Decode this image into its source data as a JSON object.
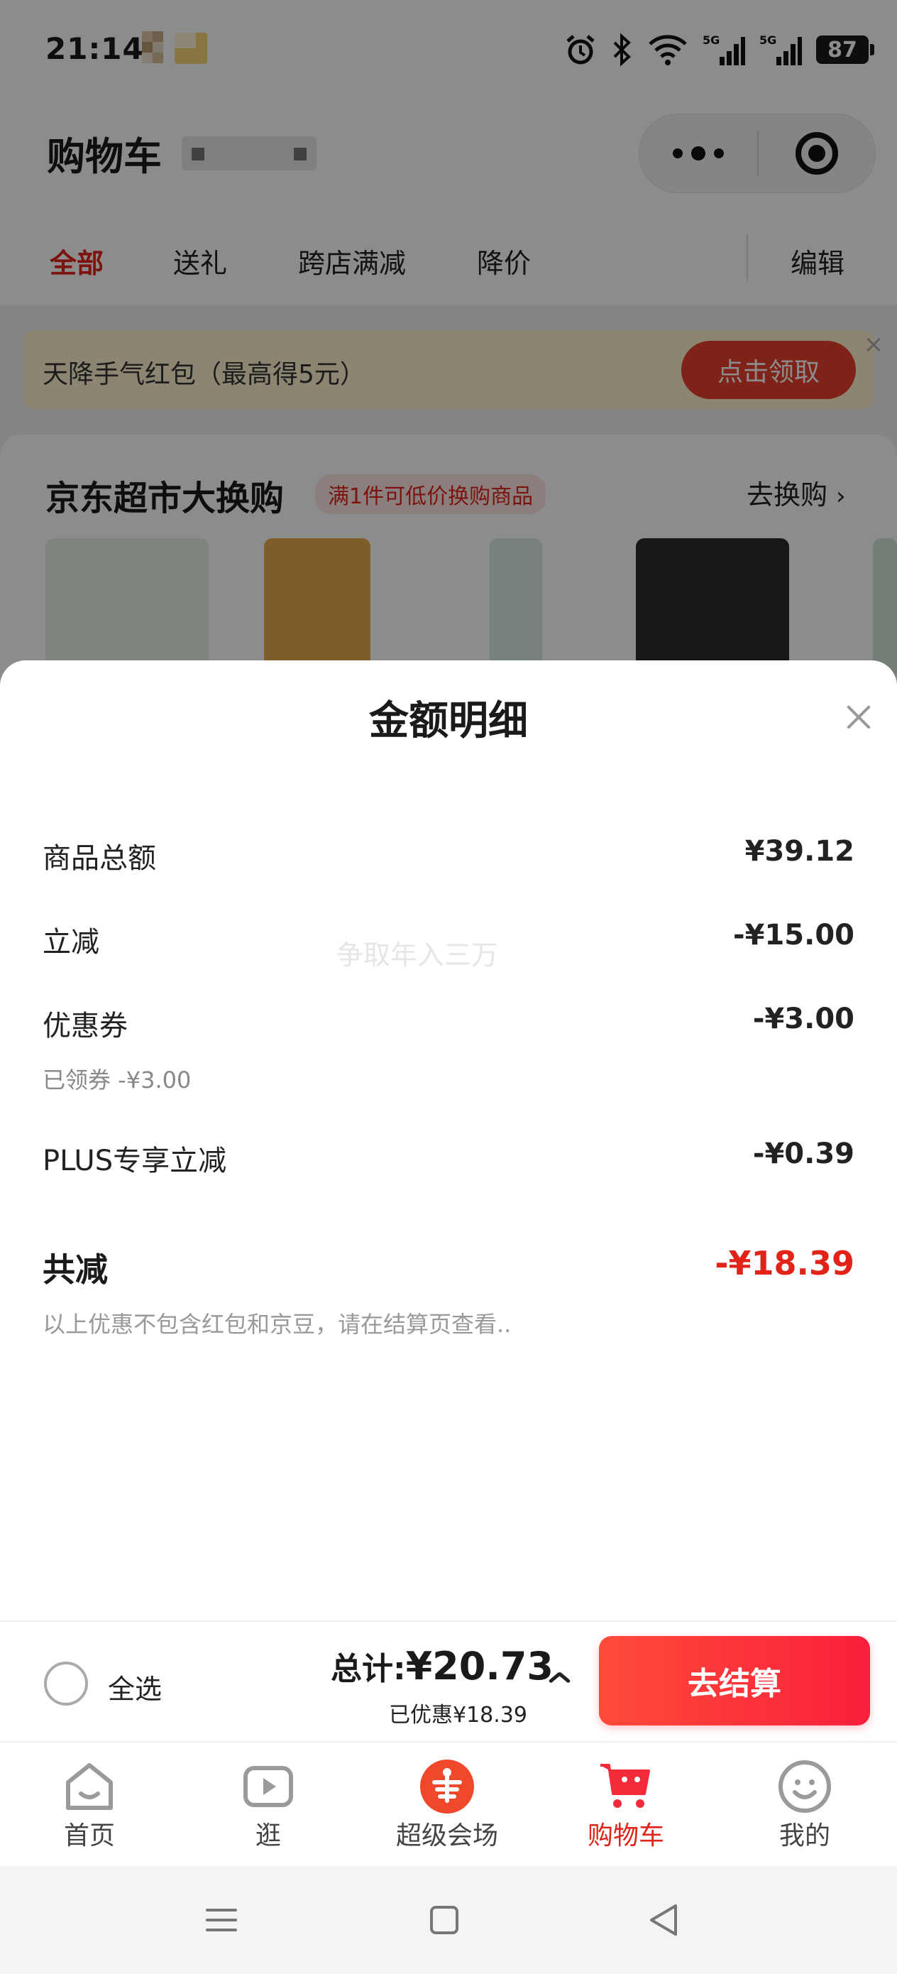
{
  "status_bar": {
    "time": "21:14",
    "battery": "87"
  },
  "header": {
    "title": "购物车"
  },
  "tabs": [
    {
      "label": "全部",
      "active": true
    },
    {
      "label": "送礼"
    },
    {
      "label": "跨店满减"
    },
    {
      "label": "降价"
    }
  ],
  "tabs_edit": "编辑",
  "banner": {
    "text": "天降手气红包（最高得5元）",
    "button": "点击领取"
  },
  "swap": {
    "title": "京东超市大换购",
    "tag": "满1件可低价换购商品",
    "link": "去换购",
    "link_arrow": "›"
  },
  "sheet": {
    "title": "金额明细",
    "watermark": "争取年入三万",
    "rows": [
      {
        "label": "商品总额",
        "value": "¥39.12"
      },
      {
        "label": "立减",
        "value": "-¥15.00"
      },
      {
        "label": "优惠券",
        "value": "-¥3.00",
        "sub": "已领券 -¥3.00"
      },
      {
        "label": "PLUS专享立减",
        "value": "-¥0.39"
      }
    ],
    "total": {
      "label": "共减",
      "value": "-¥18.39"
    },
    "note": "以上优惠不包含红包和京豆，请在结算页查看.."
  },
  "checkout": {
    "select_all": "全选",
    "total_prefix": "总计:",
    "total_amount": "¥20.73",
    "saved": "已优惠¥18.39",
    "pay_button": "去结算"
  },
  "tabbar": [
    {
      "label": "首页",
      "icon": "home-icon"
    },
    {
      "label": "逛",
      "icon": "video-icon"
    },
    {
      "label": "超级会场",
      "icon": "super-venue-icon"
    },
    {
      "label": "购物车",
      "icon": "cart-icon",
      "active": true
    },
    {
      "label": "我的",
      "icon": "profile-icon"
    }
  ],
  "colors": {
    "accent": "#e2231a",
    "pay_button": "#f91f3b",
    "banner_bg": "#fdf2d0"
  }
}
